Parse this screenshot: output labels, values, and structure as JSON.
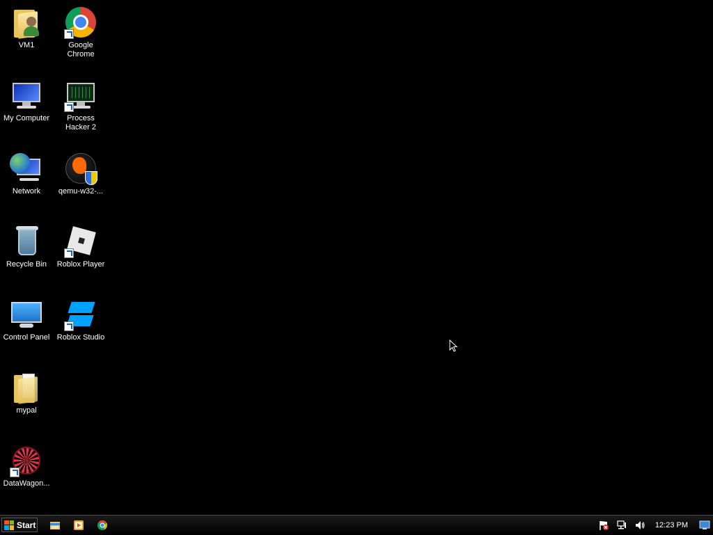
{
  "desktop": {
    "icons": [
      {
        "label": "VM1"
      },
      {
        "label": "Google Chrome"
      },
      {
        "label": "My Computer"
      },
      {
        "label": "Process Hacker 2"
      },
      {
        "label": "Network"
      },
      {
        "label": "qemu-w32-..."
      },
      {
        "label": "Recycle Bin"
      },
      {
        "label": "Roblox Player"
      },
      {
        "label": "Control Panel"
      },
      {
        "label": "Roblox Studio"
      },
      {
        "label": "mypal"
      },
      {
        "label": "DataWagon..."
      }
    ]
  },
  "taskbar": {
    "start_label": "Start",
    "pinned": [
      {
        "icon": "file-explorer-icon"
      },
      {
        "icon": "media-player-icon"
      },
      {
        "icon": "chrome-icon"
      }
    ],
    "tray": {
      "icons": [
        "action-center-flag-icon",
        "network-icon",
        "volume-icon",
        "show-desktop-icon"
      ],
      "clock": "12:23 PM"
    }
  }
}
